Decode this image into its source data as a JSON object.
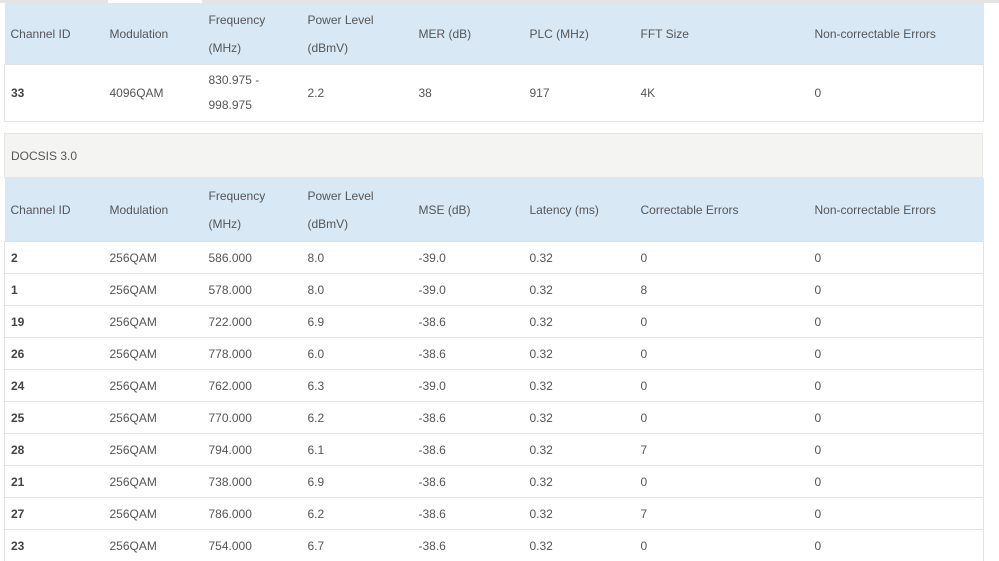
{
  "ofdm": {
    "headers": [
      "Channel ID",
      "Modulation",
      "Frequency",
      "(MHz)",
      "Power Level",
      "(dBmV)",
      "MER (dB)",
      "PLC (MHz)",
      "FFT Size",
      "Non-correctable Errors"
    ],
    "row": {
      "channel": "33",
      "modulation": "4096QAM",
      "freq_line1": "830.975 -",
      "freq_line2": "998.975",
      "power": "2.2",
      "mer": "38",
      "plc": "917",
      "fft": "4K",
      "noncorr": "0"
    }
  },
  "docsis30": {
    "title": "DOCSIS 3.0",
    "headers": [
      "Channel ID",
      "Modulation",
      "Frequency",
      "(MHz)",
      "Power Level",
      "(dBmV)",
      "MSE (dB)",
      "Latency (ms)",
      "Correctable Errors",
      "Non-correctable Errors"
    ],
    "rows": [
      [
        "2",
        "256QAM",
        "586.000",
        "8.0",
        "-39.0",
        "0.32",
        "0",
        "0"
      ],
      [
        "1",
        "256QAM",
        "578.000",
        "8.0",
        "-39.0",
        "0.32",
        "8",
        "0"
      ],
      [
        "19",
        "256QAM",
        "722.000",
        "6.9",
        "-38.6",
        "0.32",
        "0",
        "0"
      ],
      [
        "26",
        "256QAM",
        "778.000",
        "6.0",
        "-38.6",
        "0.32",
        "0",
        "0"
      ],
      [
        "24",
        "256QAM",
        "762.000",
        "6.3",
        "-39.0",
        "0.32",
        "0",
        "0"
      ],
      [
        "25",
        "256QAM",
        "770.000",
        "6.2",
        "-38.6",
        "0.32",
        "0",
        "0"
      ],
      [
        "28",
        "256QAM",
        "794.000",
        "6.1",
        "-38.6",
        "0.32",
        "7",
        "0"
      ],
      [
        "21",
        "256QAM",
        "738.000",
        "6.9",
        "-38.6",
        "0.32",
        "0",
        "0"
      ],
      [
        "27",
        "256QAM",
        "786.000",
        "6.2",
        "-38.6",
        "0.32",
        "7",
        "0"
      ],
      [
        "23",
        "256QAM",
        "754.000",
        "6.7",
        "-38.6",
        "0.32",
        "0",
        "0"
      ]
    ]
  }
}
